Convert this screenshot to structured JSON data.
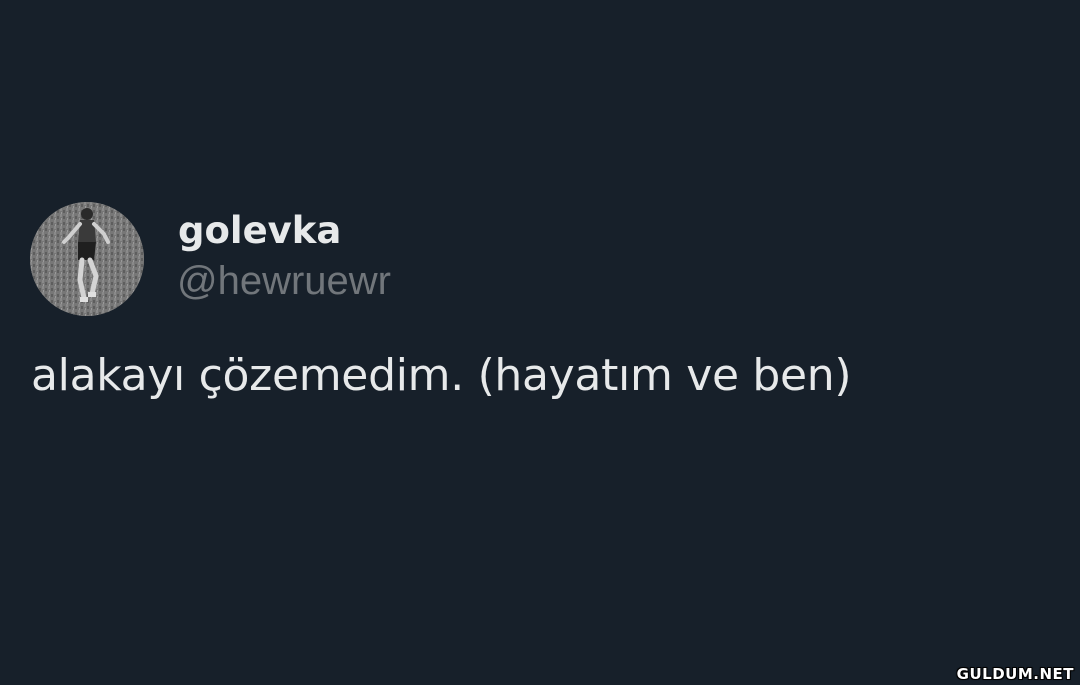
{
  "tweet": {
    "author": {
      "display_name": "golevka",
      "handle": "@hewruewr",
      "avatar_icon": "runner-photo-avatar"
    },
    "text": "alakayı çözemedim. (hayatım ve ben)"
  },
  "watermark": {
    "text": "GULDUM.NET"
  },
  "colors": {
    "background": "#17202a",
    "primary_text": "#e7e9ea",
    "secondary_text": "#71767b"
  }
}
